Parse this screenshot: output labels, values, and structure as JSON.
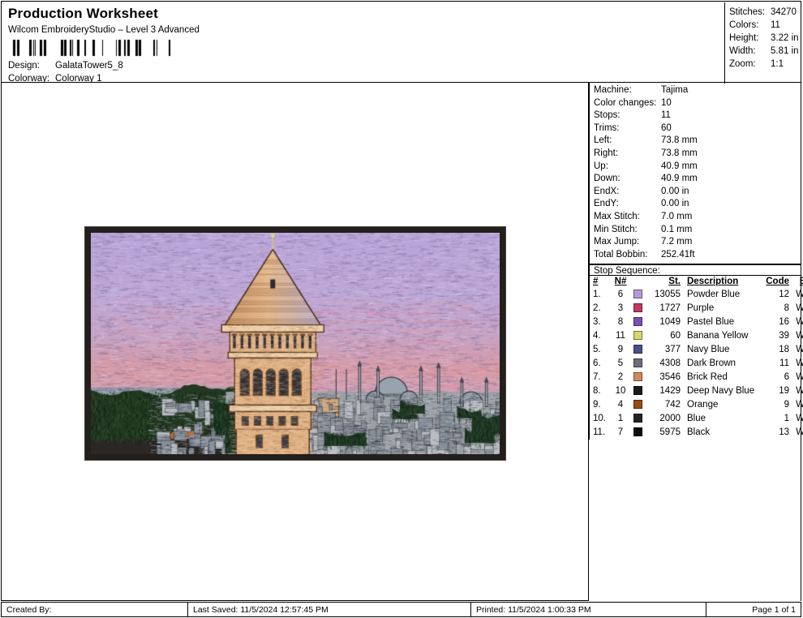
{
  "header": {
    "title": "Production Worksheet",
    "subtitle": "Wilcom EmbroideryStudio – Level 3 Advanced",
    "design_label": "Design:",
    "design_value": "GalataTower5_8",
    "colorway_label": "Colorway:",
    "colorway_value": "Colorway 1",
    "barcode_icon": "barcode"
  },
  "stats": {
    "rows": [
      {
        "label": "Stitches:",
        "value": "34270"
      },
      {
        "label": "Colors:",
        "value": "11"
      },
      {
        "label": "Height:",
        "value": "3.22 in"
      },
      {
        "label": "Width:",
        "value": "5.81 in"
      },
      {
        "label": "Zoom:",
        "value": "1:1"
      }
    ]
  },
  "machine": {
    "rows": [
      {
        "label": "Machine:",
        "value": "Tajima"
      },
      {
        "label": "Color changes:",
        "value": "10"
      },
      {
        "label": "Stops:",
        "value": "11"
      },
      {
        "label": "Trims:",
        "value": "60"
      },
      {
        "label": "Left:",
        "value": "73.8 mm"
      },
      {
        "label": "Right:",
        "value": "73.8 mm"
      },
      {
        "label": "Up:",
        "value": "40.9 mm"
      },
      {
        "label": "Down:",
        "value": "40.9 mm"
      },
      {
        "label": "EndX:",
        "value": "0.00 in"
      },
      {
        "label": "EndY:",
        "value": "0.00 in"
      },
      {
        "label": "Max Stitch:",
        "value": "7.0 mm"
      },
      {
        "label": "Min Stitch:",
        "value": "0.1 mm"
      },
      {
        "label": "Max Jump:",
        "value": "7.2 mm"
      },
      {
        "label": "Total Bobbin:",
        "value": "252.41ft"
      }
    ]
  },
  "stop_sequence": {
    "title": "Stop Sequence:",
    "columns": [
      "#",
      "N#",
      "",
      "St.",
      "Description",
      "Code",
      "Brand"
    ],
    "rows": [
      {
        "idx": "1.",
        "n": "6",
        "color": "#b69ad8",
        "st": "13055",
        "description": "Powder Blue",
        "code": "12",
        "brand": "Wilcom"
      },
      {
        "idx": "2.",
        "n": "3",
        "color": "#c13a62",
        "st": "1727",
        "description": "Purple",
        "code": "8",
        "brand": "Wilcom"
      },
      {
        "idx": "3.",
        "n": "8",
        "color": "#7b4fb5",
        "st": "1049",
        "description": "Pastel Blue",
        "code": "16",
        "brand": "Wilcom"
      },
      {
        "idx": "4.",
        "n": "11",
        "color": "#d7d471",
        "st": "60",
        "description": "Banana Yellow",
        "code": "39",
        "brand": "Wilcom"
      },
      {
        "idx": "5.",
        "n": "9",
        "color": "#4a5183",
        "st": "377",
        "description": "Navy Blue",
        "code": "18",
        "brand": "Wilcom"
      },
      {
        "idx": "6.",
        "n": "5",
        "color": "#6e6e78",
        "st": "4308",
        "description": "Dark Brown",
        "code": "11",
        "brand": "Wilcom"
      },
      {
        "idx": "7.",
        "n": "2",
        "color": "#d08a5e",
        "st": "3546",
        "description": "Brick Red",
        "code": "6",
        "brand": "Wilcom"
      },
      {
        "idx": "8.",
        "n": "10",
        "color": "#1b1b1f",
        "st": "1429",
        "description": "Deep Navy Blue",
        "code": "19",
        "brand": "Wilcom"
      },
      {
        "idx": "9.",
        "n": "4",
        "color": "#9c4a14",
        "st": "742",
        "description": "Orange",
        "code": "9",
        "brand": "Wilcom"
      },
      {
        "idx": "10.",
        "n": "1",
        "color": "#23231f",
        "st": "2000",
        "description": "Blue",
        "code": "1",
        "brand": "Wilcom"
      },
      {
        "idx": "11.",
        "n": "7",
        "color": "#0d0d0d",
        "st": "5975",
        "description": "Black",
        "code": "13",
        "brand": "Wilcom"
      }
    ]
  },
  "design_preview": {
    "name": "galata-tower-embroidery",
    "frame_color": "#231f1d",
    "sky_top": "#b9a4d8",
    "sky_mid": "#c2a6d0",
    "sky_pink": "#e3909a",
    "tower_color": "#e0b285",
    "foliage_color": "#1e3524",
    "roof_color": "#c06a33",
    "building_color": "#9aa0a6"
  },
  "footer": {
    "created_by": "Created By:",
    "last_saved": "Last Saved: 11/5/2024 12:57:45 PM",
    "printed": "Printed: 11/5/2024 1:00:33 PM",
    "page": "Page 1 of 1"
  }
}
